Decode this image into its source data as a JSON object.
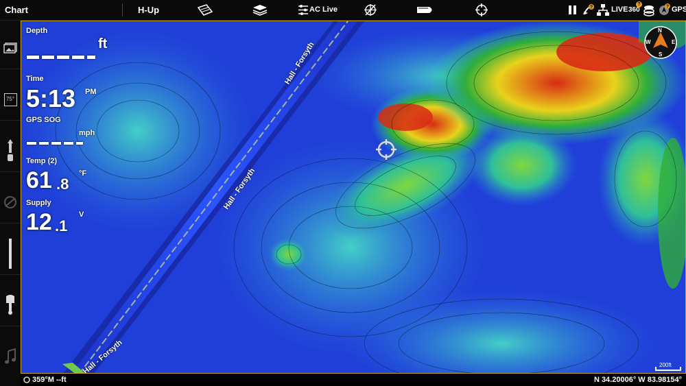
{
  "topbar": {
    "title": "Chart",
    "orientation": "H-Up",
    "ac_live_label": "AC Live",
    "live_label": "LIVE",
    "live360_label": "360",
    "gps_label": "GPS",
    "badge_sonar": "?",
    "badge_360": "?",
    "badge_gps": "?"
  },
  "map": {
    "labels": {
      "road_label": "Hall - Forsyth"
    },
    "scale_text": "200ft",
    "compass": {
      "n": "N",
      "e": "E",
      "s": "S",
      "w": "W"
    }
  },
  "overlay": {
    "depth_title": "Depth",
    "depth_unit": "ft",
    "time_title": "Time",
    "time_value": "5:13",
    "time_ampm": "PM",
    "sog_title": "GPS SOG",
    "sog_unit": "mph",
    "temp_title": "Temp (2)",
    "temp_main": "61",
    "temp_dec": ".8",
    "temp_unit": "°F",
    "supply_title": "Supply",
    "supply_main": "12",
    "supply_dec": ".1",
    "supply_unit": "V"
  },
  "sidebar": {
    "temp_icon_label": "75°"
  },
  "bottombar": {
    "heading": "359°M --ft",
    "position": "N 34.20006° W 83.98154°"
  },
  "colors": {
    "deep": "#1f3fd8",
    "shallow_green": "#2fae3a",
    "high_red": "#d82b14",
    "yellow": "#e9d21c",
    "border_gold": "#c9a22a"
  }
}
